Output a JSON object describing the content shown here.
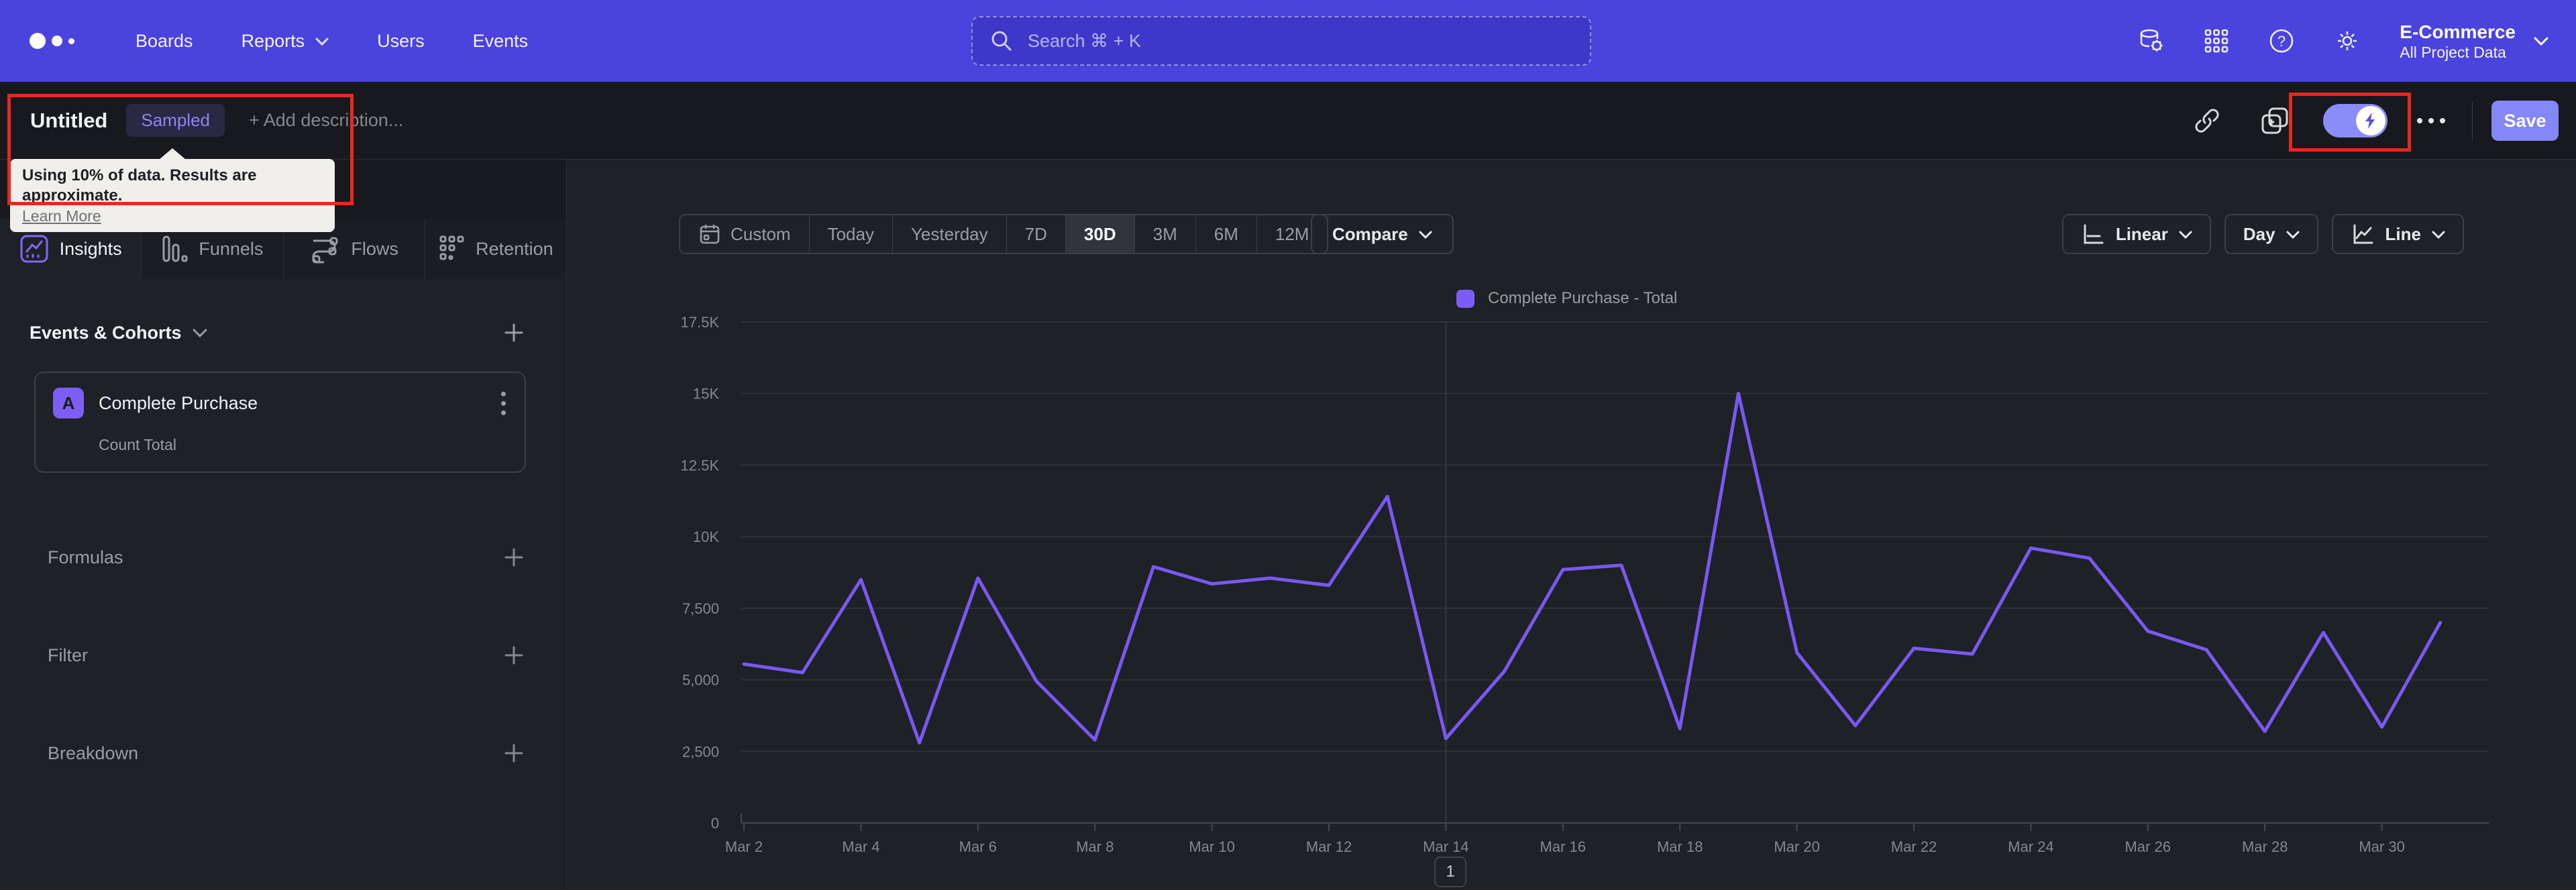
{
  "navbar": {
    "items": [
      {
        "label": "Boards",
        "chevron": false
      },
      {
        "label": "Reports",
        "chevron": true
      },
      {
        "label": "Users",
        "chevron": false
      },
      {
        "label": "Events",
        "chevron": false
      }
    ],
    "search_placeholder": "Search  ⌘ + K",
    "project": {
      "name": "E-Commerce",
      "scope": "All Project Data"
    }
  },
  "toolbar": {
    "title": "Untitled",
    "badge": "Sampled",
    "add_description": "+ Add description...",
    "save_label": "Save"
  },
  "tooltip": {
    "line1": "Using 10% of data. Results are approximate.",
    "link": "Learn More"
  },
  "sidebar": {
    "tabs": [
      {
        "label": "Insights",
        "active": true
      },
      {
        "label": "Funnels",
        "active": false
      },
      {
        "label": "Flows",
        "active": false
      },
      {
        "label": "Retention",
        "active": false
      }
    ],
    "events_header": "Events & Cohorts",
    "event_card": {
      "badge": "A",
      "name": "Complete Purchase",
      "sub": "Count Total"
    },
    "sections": [
      "Formulas",
      "Filter",
      "Breakdown"
    ]
  },
  "controls": {
    "ranges": [
      "Custom",
      "Today",
      "Yesterday",
      "7D",
      "30D",
      "3M",
      "6M",
      "12M"
    ],
    "active_range": "30D",
    "compare": "Compare",
    "scale": "Linear",
    "granularity": "Day",
    "chart_type": "Line"
  },
  "pagination": {
    "page": "1"
  },
  "colors": {
    "navbar": "#4b43dd",
    "accent_line": "#7a58f3",
    "legend_swatch": "#7c5cf6",
    "save_button": "#8487f8",
    "annotation_red": "#e8291c",
    "badge_purple": "#7c5ff2"
  },
  "chart_data": {
    "type": "line",
    "title": "Complete Purchase - Total",
    "legend": [
      {
        "label": "Complete Purchase - Total",
        "color": "#7c5cf6"
      }
    ],
    "categories": [
      "Mar 2",
      "Mar 3",
      "Mar 4",
      "Mar 5",
      "Mar 6",
      "Mar 7",
      "Mar 8",
      "Mar 9",
      "Mar 10",
      "Mar 11",
      "Mar 12",
      "Mar 13",
      "Mar 14",
      "Mar 15",
      "Mar 16",
      "Mar 17",
      "Mar 18",
      "Mar 19",
      "Mar 20",
      "Mar 21",
      "Mar 22",
      "Mar 23",
      "Mar 24",
      "Mar 25",
      "Mar 26",
      "Mar 27",
      "Mar 28",
      "Mar 29",
      "Mar 30",
      "Mar 31"
    ],
    "series": [
      {
        "name": "Complete Purchase - Total",
        "values": [
          5550,
          5250,
          8500,
          2800,
          8550,
          4950,
          2900,
          8950,
          8350,
          8550,
          8300,
          11400,
          2950,
          5300,
          8850,
          9000,
          3300,
          15000,
          5950,
          3400,
          6100,
          5900,
          9600,
          9250,
          6700,
          6050,
          3200,
          6650,
          3350,
          7000
        ]
      }
    ],
    "ylim": [
      0,
      17500
    ],
    "y_tick_step": 2500,
    "y_tick_labels": [
      "0",
      "2,500",
      "5,000",
      "7,500",
      "10K",
      "12.5K",
      "15K",
      "17.5K"
    ],
    "x_tick_every": 2,
    "vline_category": "Mar 14",
    "line_color": "#7a58f3",
    "xlabel": "",
    "ylabel": "",
    "grid": "horizontal"
  }
}
